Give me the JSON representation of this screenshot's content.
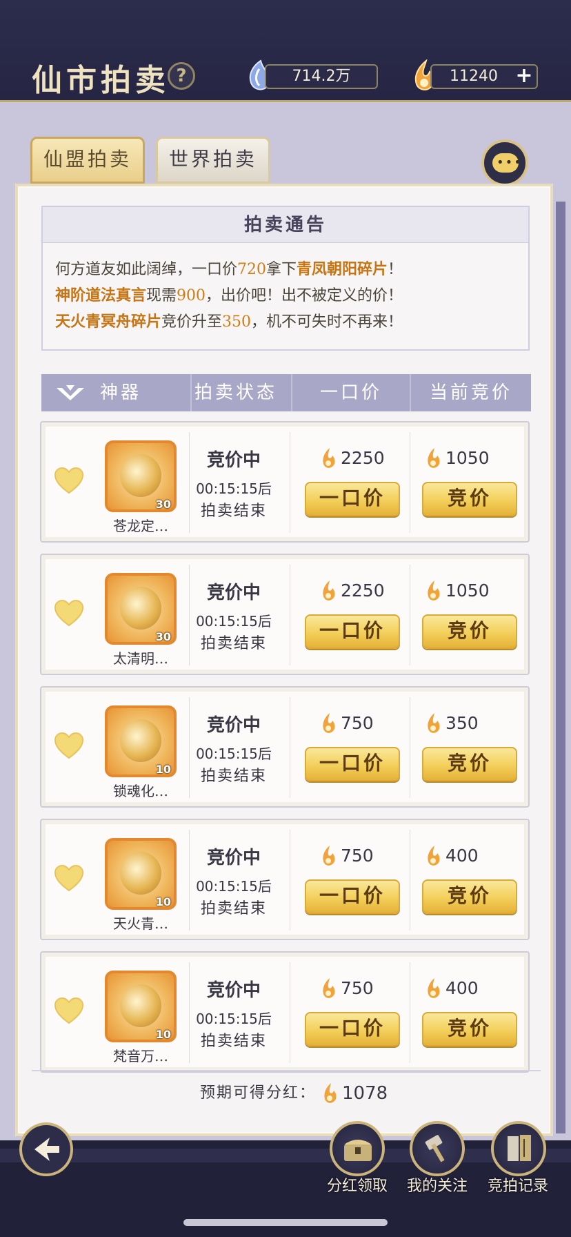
{
  "header": {
    "title": "仙市拍卖",
    "help_label": "?",
    "jade_amount": "714.2万",
    "gold_amount": "11240",
    "plus_label": "+"
  },
  "tabs": [
    {
      "label": "仙盟拍卖",
      "active": true
    },
    {
      "label": "世界拍卖",
      "active": false
    }
  ],
  "notice": {
    "title": "拍卖通告",
    "line1": {
      "a": "何方道友如此阔绰，一口价",
      "b": "720",
      "c": "拿下",
      "d": "青凤朝阳碎片",
      "e": "！"
    },
    "line2": {
      "a": "神阶道法真言",
      "b": "现需",
      "c": "900",
      "d": "，出价吧！出不被定义的价！"
    },
    "line3": {
      "a": "天火青冥舟碎片",
      "b": "竞价升至",
      "c": "350",
      "d": "，机不可失时不再来！"
    }
  },
  "table": {
    "headers": [
      "神器",
      "拍卖状态",
      "一口价",
      "当前竞价"
    ],
    "rows": [
      {
        "name": "苍龙定…",
        "count": "30",
        "status": "竞价中",
        "timer": "00:15:15后",
        "ends": "拍卖结束",
        "buyout": "2250",
        "bid": "1050",
        "buyout_label": "一口价",
        "bid_label": "竞价"
      },
      {
        "name": "太清明…",
        "count": "30",
        "status": "竞价中",
        "timer": "00:15:15后",
        "ends": "拍卖结束",
        "buyout": "2250",
        "bid": "1050",
        "buyout_label": "一口价",
        "bid_label": "竞价"
      },
      {
        "name": "锁魂化…",
        "count": "10",
        "status": "竞价中",
        "timer": "00:15:15后",
        "ends": "拍卖结束",
        "buyout": "750",
        "bid": "350",
        "buyout_label": "一口价",
        "bid_label": "竞价"
      },
      {
        "name": "天火青…",
        "count": "10",
        "status": "竞价中",
        "timer": "00:15:15后",
        "ends": "拍卖结束",
        "buyout": "750",
        "bid": "400",
        "buyout_label": "一口价",
        "bid_label": "竞价"
      },
      {
        "name": "梵音万…",
        "count": "10",
        "status": "竞价中",
        "timer": "00:15:15后",
        "ends": "拍卖结束",
        "buyout": "750",
        "bid": "400",
        "buyout_label": "一口价",
        "bid_label": "竞价"
      }
    ]
  },
  "footer": {
    "bonus_label": "预期可得分红：",
    "bonus_value": "1078"
  },
  "bottom_nav": [
    {
      "label": "分红领取",
      "icon": "chest-icon"
    },
    {
      "label": "我的关注",
      "icon": "hammer-icon"
    },
    {
      "label": "竞拍记录",
      "icon": "record-icon"
    }
  ],
  "colors": {
    "accent_gold": "#f3cf5a",
    "header_bg": "#2c2c4d",
    "highlight_orange": "#d07d14",
    "table_header": "#a9a7c7"
  }
}
